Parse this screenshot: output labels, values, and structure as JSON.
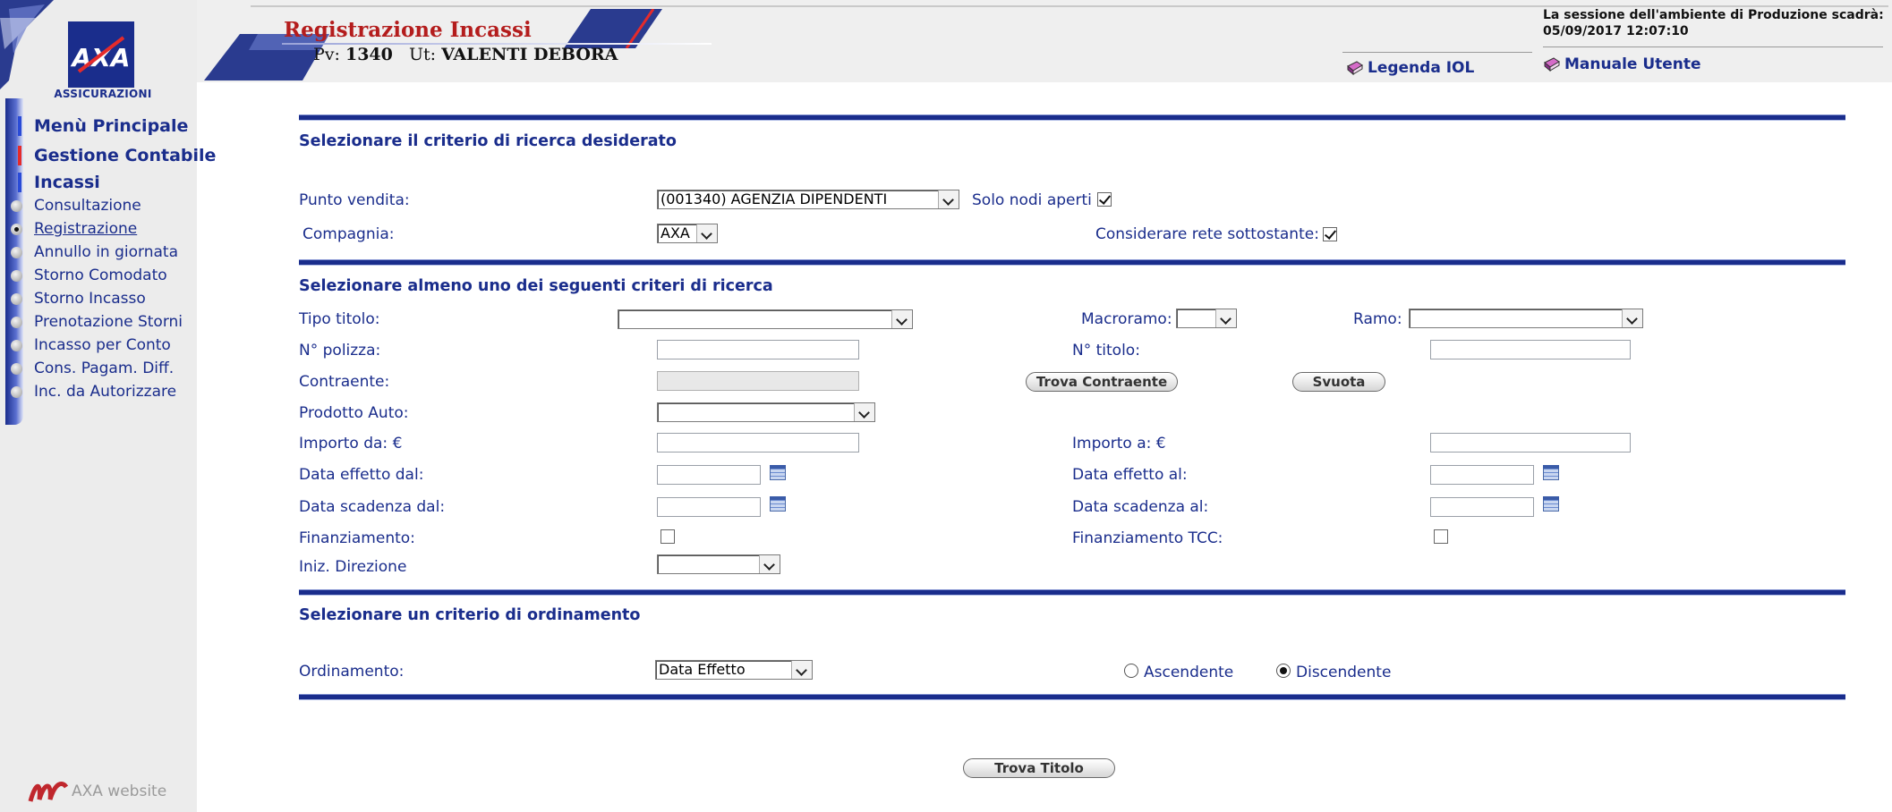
{
  "header": {
    "title": "Registrazione Incassi",
    "pv_label": "Pv:",
    "pv_value": "1340",
    "ut_label": "Ut:",
    "ut_value": "VALENTI DEBORA",
    "session_line1": "La sessione dell'ambiente di Produzione scadrà:",
    "session_line2": "05/09/2017 12:07:10",
    "legenda_link": "Legenda IOL",
    "manuale_link": "Manuale Utente"
  },
  "sidebar": {
    "logo_text": "ASSICURAZIONI",
    "main_items": [
      {
        "label": "Menù Principale"
      },
      {
        "label": "Gestione Contabile"
      },
      {
        "label": "Incassi"
      }
    ],
    "sub_items": [
      {
        "label": "Consultazione"
      },
      {
        "label": "Registrazione",
        "selected": true
      },
      {
        "label": "Annullo in giornata"
      },
      {
        "label": "Storno Comodato"
      },
      {
        "label": "Storno Incasso"
      },
      {
        "label": "Prenotazione Storni"
      },
      {
        "label": "Incasso per Conto"
      },
      {
        "label": "Cons. Pagam. Diff."
      },
      {
        "label": "Inc. da Autorizzare"
      }
    ],
    "footer_link": "AXA website"
  },
  "section1": {
    "title": "Selezionare il criterio di ricerca desiderato",
    "punto_vendita_label": "Punto vendita:",
    "punto_vendita_value": "(001340) AGENZIA DIPENDENTI",
    "solo_nodi_label": "Solo nodi aperti",
    "solo_nodi_checked": true,
    "compagnia_label": "Compagnia:",
    "compagnia_value": "AXA",
    "rete_label": "Considerare rete sottostante:",
    "rete_checked": true
  },
  "section2": {
    "title": "Selezionare almeno uno dei seguenti criteri di ricerca",
    "tipo_titolo_label": "Tipo titolo:",
    "tipo_titolo_value": "",
    "macroramo_label": "Macroramo:",
    "ramo_label": "Ramo:",
    "polizza_label": "N° polizza:",
    "titolo_label": "N° titolo:",
    "contraente_label": "Contraente:",
    "trova_contraente_btn": "Trova Contraente",
    "svuota_btn": "Svuota",
    "prodotto_auto_label": "Prodotto Auto:",
    "importo_da_label": "Importo da: €",
    "importo_a_label": "Importo a: €",
    "data_effetto_dal_label": "Data effetto dal:",
    "data_effetto_al_label": "Data effetto al:",
    "data_scadenza_dal_label": "Data scadenza dal:",
    "data_scadenza_al_label": "Data scadenza al:",
    "finanziamento_label": "Finanziamento:",
    "finanziamento_tcc_label": "Finanziamento TCC:",
    "iniz_direzione_label": "Iniz. Direzione"
  },
  "section3": {
    "title": "Selezionare un criterio di ordinamento",
    "ordinamento_label": "Ordinamento:",
    "ordinamento_value": "Data Effetto",
    "ascendente_label": "Ascendente",
    "discendente_label": "Discendente",
    "selected_order": "Discendente"
  },
  "actions": {
    "trova_titolo_btn": "Trova Titolo"
  },
  "colors": {
    "brand_blue": "#1a2d8c",
    "title_red": "#b41d1d",
    "accent_red": "#e52b2b"
  }
}
